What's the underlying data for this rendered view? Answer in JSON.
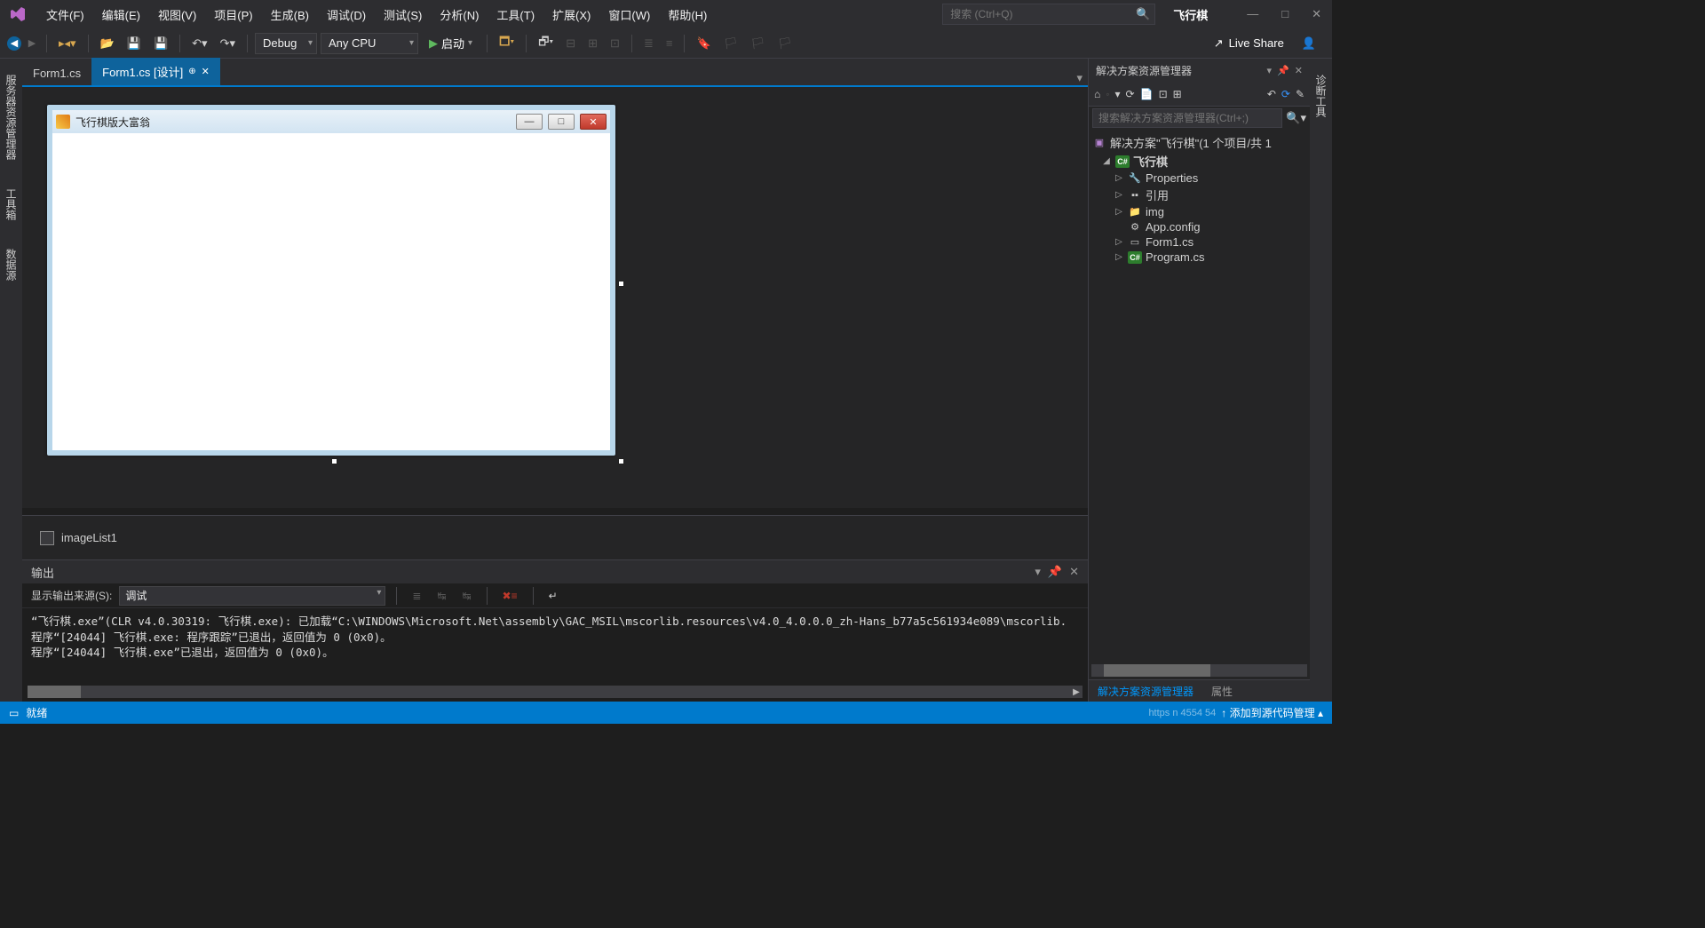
{
  "titlebar": {
    "menus": [
      "文件(F)",
      "编辑(E)",
      "视图(V)",
      "项目(P)",
      "生成(B)",
      "调试(D)",
      "测试(S)",
      "分析(N)",
      "工具(T)",
      "扩展(X)",
      "窗口(W)",
      "帮助(H)"
    ],
    "search_placeholder": "搜索 (Ctrl+Q)",
    "app_name": "飞行棋"
  },
  "toolbar": {
    "config": "Debug",
    "platform": "Any CPU",
    "start_label": "启动",
    "liveshare": "Live Share"
  },
  "tabs": {
    "items": [
      {
        "label": "Form1.cs",
        "active": false
      },
      {
        "label": "Form1.cs [设计]",
        "active": true
      }
    ]
  },
  "left_rail": [
    "服务器资源管理器",
    "工具箱",
    "数据源"
  ],
  "far_rail": "诊断工具",
  "form": {
    "title": "飞行棋版大富翁"
  },
  "component_tray": {
    "item": "imageList1"
  },
  "output": {
    "title": "输出",
    "source_label": "显示输出来源(S):",
    "source_value": "调试",
    "lines": [
      "“飞行棋.exe”(CLR v4.0.30319: 飞行棋.exe): 已加载“C:\\WINDOWS\\Microsoft.Net\\assembly\\GAC_MSIL\\mscorlib.resources\\v4.0_4.0.0.0_zh-Hans_b77a5c561934e089\\mscorlib.",
      "程序“[24044] 飞行棋.exe: 程序跟踪”已退出，返回值为 0 (0x0)。",
      "程序“[24044] 飞行棋.exe”已退出，返回值为 0 (0x0)。"
    ]
  },
  "solution_explorer": {
    "title": "解决方案资源管理器",
    "search_placeholder": "搜索解决方案资源管理器(Ctrl+;)",
    "solution_label": "解决方案\"飞行棋\"(1 个项目/共 1 ",
    "project": "飞行棋",
    "nodes": {
      "properties": "Properties",
      "references": "引用",
      "img": "img",
      "appconfig": "App.config",
      "form1": "Form1.cs",
      "program": "Program.cs"
    },
    "bottom_tabs": {
      "active": "解决方案资源管理器",
      "other": "属性"
    }
  },
  "statusbar": {
    "ready": "就绪",
    "source_control": "添加到源代码管理",
    "watermark": "https       n 4554 54"
  }
}
